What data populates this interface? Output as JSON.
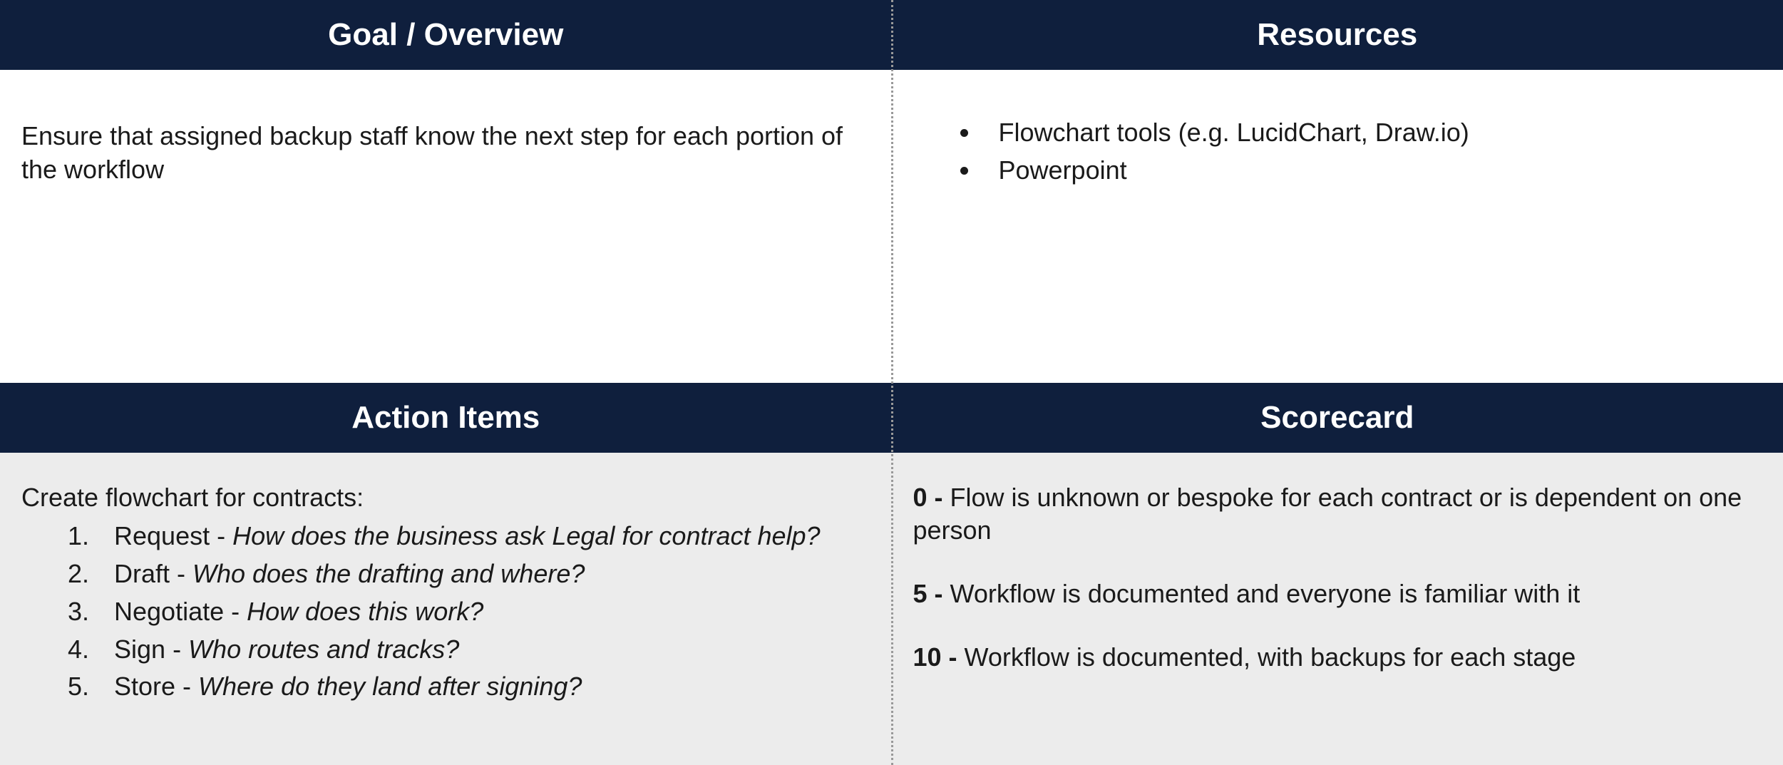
{
  "headers": {
    "goal": "Goal / Overview",
    "resources": "Resources",
    "action": "Action Items",
    "scorecard": "Scorecard"
  },
  "goal": {
    "text": "Ensure that assigned backup staff know the next step for each portion of the workflow"
  },
  "resources": {
    "items": [
      "Flowchart tools (e.g. LucidChart, Draw.io)",
      "Powerpoint"
    ]
  },
  "action": {
    "intro": "Create flowchart for contracts:",
    "steps": [
      {
        "label": "Request",
        "question": "How does the business ask Legal for contract help?"
      },
      {
        "label": "Draft",
        "question": "Who does the drafting and where?"
      },
      {
        "label": "Negotiate",
        "question": "How does this work?"
      },
      {
        "label": "Sign",
        "question": "Who routes and tracks?"
      },
      {
        "label": "Store",
        "question": "Where do they land after signing?"
      }
    ]
  },
  "scorecard": {
    "levels": [
      {
        "score": "0",
        "dash": " - ",
        "desc": "Flow is unknown or bespoke for each contract or is dependent on one person"
      },
      {
        "score": "5",
        "dash": " - ",
        "desc": "Workflow is documented and everyone is familiar with it"
      },
      {
        "score": "10",
        "dash": " - ",
        "desc": "Workflow is documented, with backups for each stage"
      }
    ]
  }
}
